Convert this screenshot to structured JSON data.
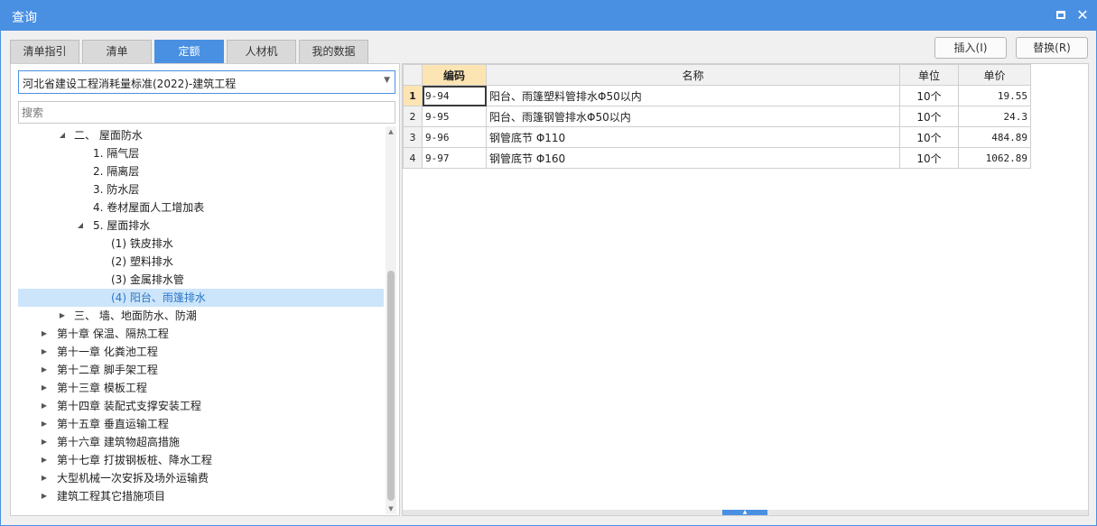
{
  "window": {
    "title": "查询"
  },
  "tabs": [
    {
      "label": "清单指引"
    },
    {
      "label": "清单"
    },
    {
      "label": "定额"
    },
    {
      "label": "人材机"
    },
    {
      "label": "我的数据"
    }
  ],
  "active_tab": "定额",
  "actions": {
    "insert": "插入(I)",
    "replace": "替换(R)"
  },
  "left": {
    "library_select": "河北省建设工程消耗量标准(2022)-建筑工程",
    "search_placeholder": "搜索",
    "tree": [
      {
        "label": "二、 屋面防水",
        "expanded": true
      },
      {
        "label": "1. 隔气层"
      },
      {
        "label": "2. 隔离层"
      },
      {
        "label": "3. 防水层"
      },
      {
        "label": "4. 卷材屋面人工增加表"
      },
      {
        "label": "5. 屋面排水",
        "expanded": true
      },
      {
        "label": "(1) 铁皮排水"
      },
      {
        "label": "(2) 塑料排水"
      },
      {
        "label": "(3) 金属排水管"
      },
      {
        "label": "(4) 阳台、雨篷排水",
        "selected": true
      },
      {
        "label": "三、 墙、地面防水、防潮",
        "expanded": false
      },
      {
        "label": "第十章 保温、隔热工程",
        "expanded": false
      },
      {
        "label": "第十一章 化粪池工程",
        "expanded": false
      },
      {
        "label": "第十二章 脚手架工程",
        "expanded": false
      },
      {
        "label": "第十三章 模板工程",
        "expanded": false
      },
      {
        "label": "第十四章 装配式支撑安装工程",
        "expanded": false
      },
      {
        "label": "第十五章 垂直运输工程",
        "expanded": false
      },
      {
        "label": "第十六章 建筑物超高措施",
        "expanded": false
      },
      {
        "label": "第十七章 打拔钢板桩、降水工程",
        "expanded": false
      },
      {
        "label": "大型机械一次安拆及场外运输费",
        "expanded": false
      },
      {
        "label": "建筑工程其它措施项目",
        "expanded": false
      }
    ]
  },
  "grid": {
    "columns": {
      "code": "编码",
      "name": "名称",
      "unit": "单位",
      "price": "单价"
    },
    "rows": [
      {
        "num": "1",
        "code": "9-94",
        "name": "阳台、雨篷塑料管排水Φ50以内",
        "unit": "10个",
        "price": "19.55"
      },
      {
        "num": "2",
        "code": "9-95",
        "name": "阳台、雨篷钢管排水Φ50以内",
        "unit": "10个",
        "price": "24.3"
      },
      {
        "num": "3",
        "code": "9-96",
        "name": "钢管底节 Φ110",
        "unit": "10个",
        "price": "484.89"
      },
      {
        "num": "4",
        "code": "9-97",
        "name": "钢管底节 Φ160",
        "unit": "10个",
        "price": "1062.89"
      }
    ]
  },
  "colors": {
    "accent": "#4a90e2",
    "selection": "#cde5fb",
    "header_highlight": "#fde5b3"
  }
}
